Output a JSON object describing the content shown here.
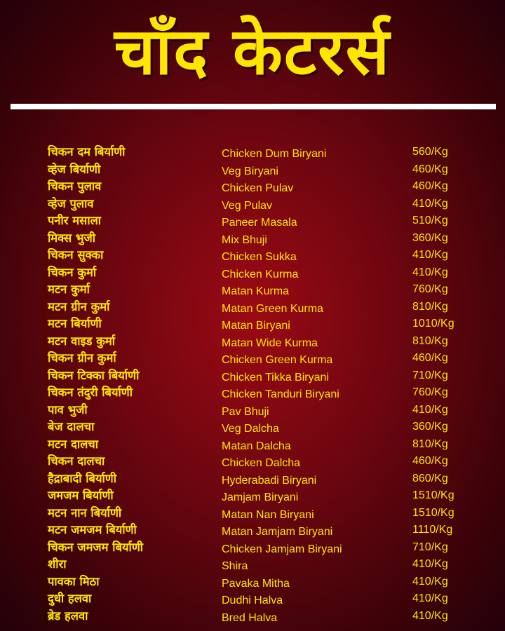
{
  "header": {
    "title": "चाँद केटरर्स"
  },
  "menu": [
    {
      "marathi": "चिकन दम बिर्याणी",
      "english": "Chicken Dum Biryani",
      "price": "560/Kg"
    },
    {
      "marathi": "व्हेज बिर्याणी",
      "english": "Veg Biryani",
      "price": "460/Kg"
    },
    {
      "marathi": "चिकन पुलाव",
      "english": "Chicken Pulav",
      "price": "460/Kg"
    },
    {
      "marathi": "व्हेज पुलाव",
      "english": "Veg Pulav",
      "price": "410/Kg"
    },
    {
      "marathi": "पनीर मसाला",
      "english": "Paneer Masala",
      "price": "510/Kg"
    },
    {
      "marathi": "मिक्स भुजी",
      "english": "Mix Bhuji",
      "price": "360/Kg"
    },
    {
      "marathi": "चिकन सुक्का",
      "english": "Chicken Sukka",
      "price": "410/Kg"
    },
    {
      "marathi": "चिकन कुर्मा",
      "english": "Chicken Kurma",
      "price": "410/Kg"
    },
    {
      "marathi": "मटन कुर्मा",
      "english": "Matan Kurma",
      "price": "760/Kg"
    },
    {
      "marathi": "मटन ग्रीन कुर्मा",
      "english": "Matan Green Kurma",
      "price": "810/Kg"
    },
    {
      "marathi": "मटन बिर्याणी",
      "english": "Matan Biryani",
      "price": "1010/Kg"
    },
    {
      "marathi": "मटन वाइड कुर्मा",
      "english": "Matan Wide Kurma",
      "price": "810/Kg"
    },
    {
      "marathi": "चिकन ग्रीन कुर्मा",
      "english": "Chicken Green Kurma",
      "price": "460/Kg"
    },
    {
      "marathi": "चिकन टिक्का बिर्याणी",
      "english": "Chicken Tikka Biryani",
      "price": "710/Kg"
    },
    {
      "marathi": "चिकन तंदुरी बिर्याणी",
      "english": "Chicken Tanduri Biryani",
      "price": "760/Kg"
    },
    {
      "marathi": "पाव भुजी",
      "english": "Pav Bhuji",
      "price": "410/Kg"
    },
    {
      "marathi": "बेज दालचा",
      "english": "Veg Dalcha",
      "price": "360/Kg"
    },
    {
      "marathi": "मटन दालचा",
      "english": "Matan Dalcha",
      "price": "810/Kg"
    },
    {
      "marathi": "चिकन दालचा",
      "english": "Chicken Dalcha",
      "price": "460/Kg"
    },
    {
      "marathi": "हैद्राबादी बिर्याणी",
      "english": "Hyderabadi Biryani",
      "price": "860/Kg"
    },
    {
      "marathi": "जमजम बिर्याणी",
      "english": "Jamjam Biryani",
      "price": "1510/Kg"
    },
    {
      "marathi": "मटन नान बिर्याणी",
      "english": "Matan Nan Biryani",
      "price": "1510/Kg"
    },
    {
      "marathi": "मटन जमजम बिर्याणी",
      "english": "Matan Jamjam Biryani",
      "price": "1110/Kg"
    },
    {
      "marathi": "चिकन जमजम बिर्याणी",
      "english": "Chicken Jamjam Biryani",
      "price": "710/Kg"
    },
    {
      "marathi": "शीरा",
      "english": "Shira",
      "price": "410/Kg"
    },
    {
      "marathi": "पावका मिठा",
      "english": "Pavaka Mitha",
      "price": "410/Kg"
    },
    {
      "marathi": "दुधी हलवा",
      "english": "Dudhi Halva",
      "price": "410/Kg"
    },
    {
      "marathi": "ब्रेड हलवा",
      "english": "Bred Halva",
      "price": "410/Kg"
    }
  ],
  "colors": {
    "text": "#ffe600",
    "background": "#7a0812",
    "divider": "#ffffff"
  }
}
